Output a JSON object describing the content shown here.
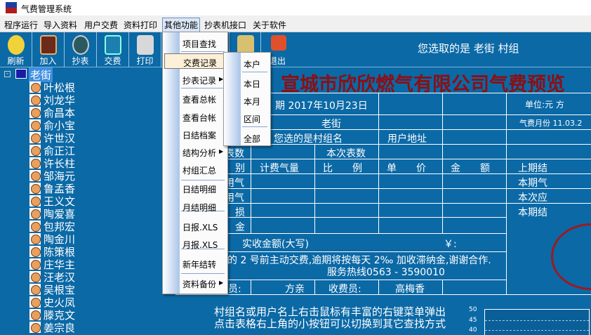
{
  "window": {
    "title": "气费管理系统"
  },
  "menubar": [
    "程序运行",
    "导入资料",
    "用户交费",
    "资料打印",
    "其他功能",
    "抄表机接口",
    "关于软件"
  ],
  "toolbar": [
    "刷新",
    "加入",
    "抄表",
    "交费",
    "打印",
    "退出"
  ],
  "selection_text": "您选取的是 老街 村组",
  "tree": {
    "root": "老街",
    "items": [
      "叶松根",
      "刘龙华",
      "俞昌本",
      "俞小宝",
      "许世汉",
      "俞正江",
      "许长柱",
      "邹海元",
      "鲁孟香",
      "王义文",
      "陶爱喜",
      "包邦宏",
      "陶金川",
      "陈策根",
      "庄华主",
      "汪老汉",
      "吴根宝",
      "史火凤",
      "滕克文",
      "姜宗良"
    ]
  },
  "menu": {
    "items": [
      "项目查找",
      "交费记录",
      "抄表记录",
      "查看总帐",
      "查看台帐",
      "日结档案",
      "结构分析",
      "村组汇总",
      "日结明细",
      "月结明细",
      "日报.XLS",
      "月报.XLS",
      "新年结转",
      "资料备份"
    ]
  },
  "submenu": [
    "本户",
    "本日",
    "本月",
    "区间",
    "全部"
  ],
  "receipt": {
    "title": "宣城市欣欣燃气有限公司气费预览",
    "date": "期 2017年10月23日",
    "unit": "单位:元 方",
    "village": "老街",
    "month": "气费月份 11.03.2",
    "village_label": "您选的是村组名",
    "address_label": "用户地址",
    "prev_reading": "表数",
    "curr_reading": "本次表数",
    "headers": [
      "别",
      "计费气量",
      "比　　例",
      "单　　价",
      "金　　额",
      "上期结"
    ],
    "rows": [
      "用气",
      "用气",
      "损",
      "金"
    ],
    "right": [
      "本期气",
      "本次应",
      "本期结"
    ],
    "amount_label": "实收金额(大写)",
    "yen": "￥:",
    "notice": "月的 2 号前主动交费,逾期将按每天 2‰ 加收滞纳金,谢谢合作.",
    "hotline": "服务热线0563 - 3590010",
    "reader_label": "员:",
    "reader": "方亲",
    "cashier_label": "收费员:",
    "cashier": "高梅香"
  },
  "hints": [
    "村组名或用户名上右击鼠标有丰富的右键菜单弹出",
    "点击表格右上角的小按钮可以切换到其它查找方式"
  ],
  "chart_data": {
    "type": "line",
    "yticks": [
      "50",
      "45",
      "40"
    ],
    "series": []
  }
}
